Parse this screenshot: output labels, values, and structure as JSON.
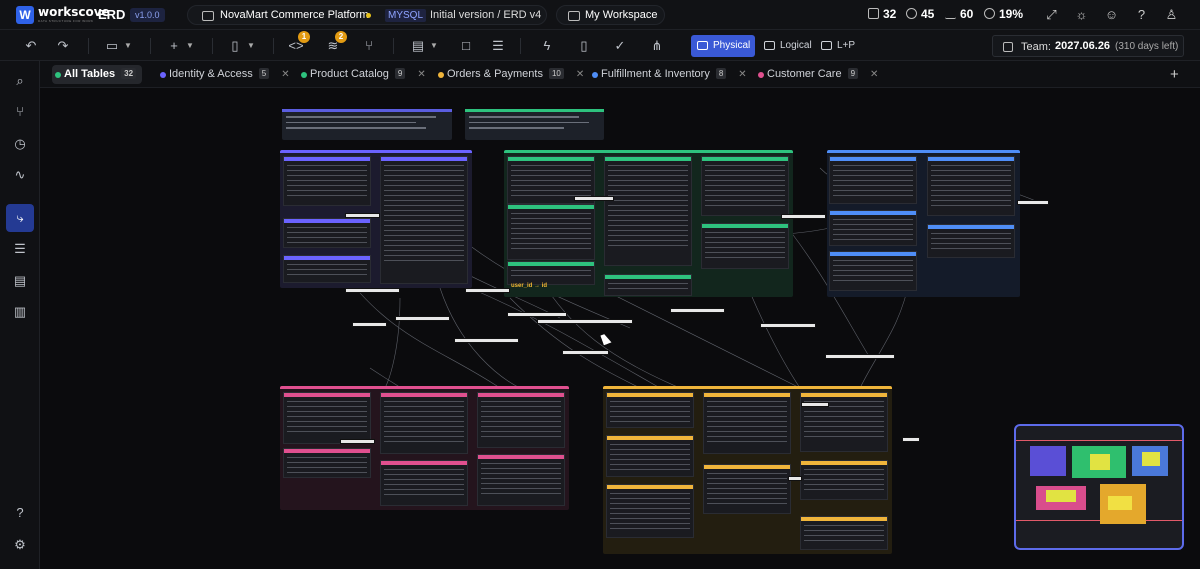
{
  "app": {
    "logo_letter": "W",
    "name": "workscove",
    "tagline": "DATA STRUCTURE FOR WORK",
    "product": "ERD",
    "version": "v1.0.0"
  },
  "project": {
    "name": "NovaMart Commerce Platform",
    "db": "MYSQL",
    "version_label": "Initial version / ERD v4",
    "workspace": "My Workspace"
  },
  "stats": {
    "tables": "32",
    "relations": "45",
    "activity": "60",
    "zoom": "19%"
  },
  "toolbar": {
    "badge_one": "1",
    "badge_two": "2",
    "view_physical": "Physical",
    "view_logical": "Logical",
    "view_lp": "L+P",
    "team_label": "Team:",
    "team_date": "2027.06.26",
    "team_remaining": "(310 days left)"
  },
  "tabs": [
    {
      "label": "All Tables",
      "count": "32",
      "color": "#2ec27e"
    },
    {
      "label": "Identity & Access",
      "count": "5",
      "color": "#6b63ff"
    },
    {
      "label": "Product Catalog",
      "count": "9",
      "color": "#2ec27e"
    },
    {
      "label": "Orders & Payments",
      "count": "10",
      "color": "#f0b53b"
    },
    {
      "label": "Fulfillment & Inventory",
      "count": "8",
      "color": "#4f8ef7"
    },
    {
      "label": "Customer Care",
      "count": "9",
      "color": "#e0508f"
    }
  ],
  "canvas": {
    "highlight_relation": "user_id → id"
  },
  "icons": {
    "topbar": [
      "grid-icon",
      "link-icon",
      "activity-icon",
      "zoom-icon",
      "expand-icon",
      "sun-icon",
      "users-icon",
      "help-icon",
      "user-icon"
    ],
    "toolbar": [
      "undo-icon",
      "redo-icon",
      "folder-icon",
      "plus-icon",
      "trash-icon",
      "code-icon",
      "layers-icon",
      "branch-icon",
      "layout-icon",
      "square-icon",
      "list-icon",
      "bolt-icon",
      "book-icon",
      "check-icon",
      "share-icon"
    ],
    "sidebar": [
      "search-icon",
      "git-branch-icon",
      "history-icon",
      "pulse-icon",
      "relation-icon",
      "list-icon",
      "document-icon",
      "chart-icon",
      "help-icon",
      "settings-icon"
    ]
  },
  "colors": {
    "accent": "#3a59d6",
    "identity": "#6b63ff",
    "catalog": "#2ec27e",
    "orders": "#f0b53b",
    "fulfillment": "#4f8ef7",
    "care": "#e0508f"
  }
}
